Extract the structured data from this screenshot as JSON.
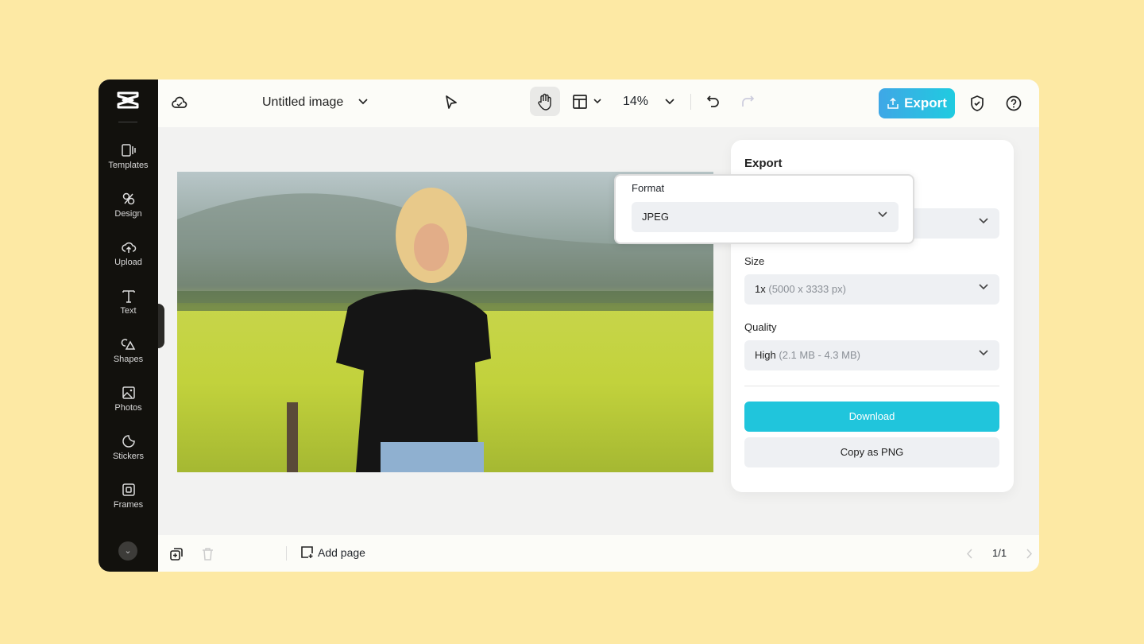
{
  "sidebar": {
    "items": [
      {
        "label": "Templates",
        "icon": "templates-icon"
      },
      {
        "label": "Design",
        "icon": "design-icon"
      },
      {
        "label": "Upload",
        "icon": "upload-icon"
      },
      {
        "label": "Text",
        "icon": "text-icon"
      },
      {
        "label": "Shapes",
        "icon": "shapes-icon"
      },
      {
        "label": "Photos",
        "icon": "photos-icon"
      },
      {
        "label": "Stickers",
        "icon": "stickers-icon"
      },
      {
        "label": "Frames",
        "icon": "frames-icon"
      }
    ]
  },
  "header": {
    "title": "Untitled image",
    "zoom": "14%",
    "export_label": "Export"
  },
  "export_panel": {
    "title": "Export",
    "format_label": "Format",
    "format_value": "JPEG",
    "size_label": "Size",
    "size_value": "1x",
    "size_detail": "(5000 x 3333 px)",
    "quality_label": "Quality",
    "quality_value": "High",
    "quality_detail": "(2.1 MB - 4.3 MB)",
    "download_label": "Download",
    "copy_label": "Copy as PNG"
  },
  "footer": {
    "add_page": "Add page",
    "page_indicator": "1/1"
  },
  "colors": {
    "accent": "#20c5dc",
    "sidebar": "#12110d",
    "background": "#fde9a4"
  }
}
